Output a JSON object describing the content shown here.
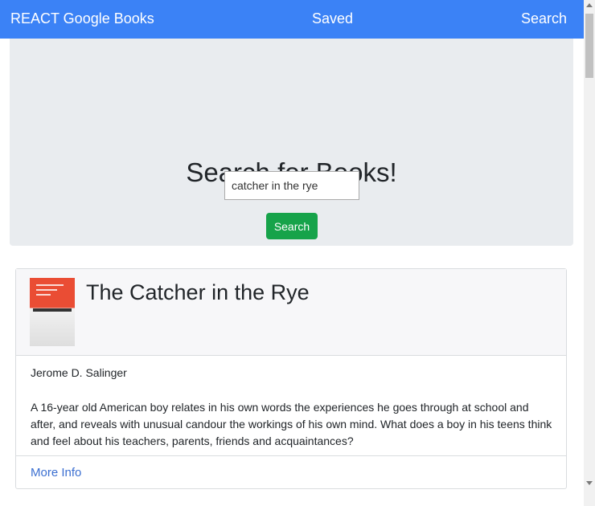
{
  "navbar": {
    "brand": "REACT Google Books",
    "saved_label": "Saved",
    "search_label": "Search"
  },
  "jumbotron": {
    "title": "Search for Books!",
    "search_value": "catcher in the rye",
    "search_button_label": "Search"
  },
  "results": [
    {
      "title": "The Catcher in the Rye",
      "author": "Jerome D. Salinger",
      "description": "A 16-year old American boy relates in his own words the experiences he goes through at school and after, and reveals with unusual candour the workings of his own mind. What does a boy in his teens think and feel about his teachers, parents, friends and acquaintances?",
      "link_label": "More Info",
      "cover_icon": "book-cover-thumbnail"
    }
  ],
  "colors": {
    "navbar": "#3b82f6",
    "jumbotron": "#e9ecef",
    "search_button": "#16a34a",
    "link": "#3b6fd1"
  }
}
